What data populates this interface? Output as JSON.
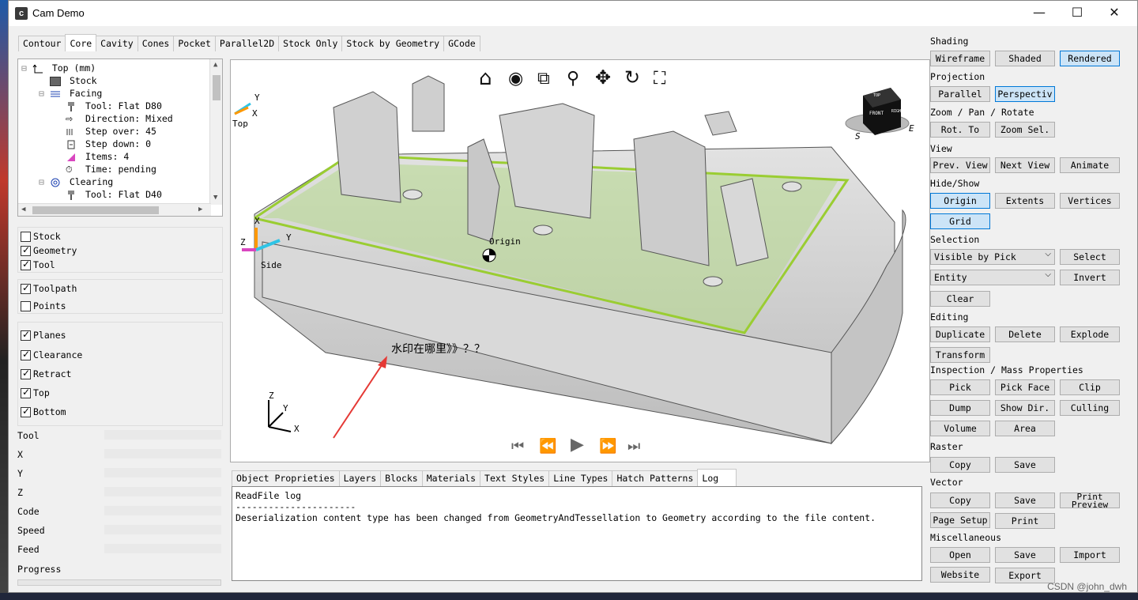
{
  "window": {
    "title": "Cam Demo",
    "icon_letter": "c",
    "min": "—",
    "max": "☐",
    "close": "✕"
  },
  "top_tabs": [
    "Contour",
    "Core",
    "Cavity",
    "Cones",
    "Pocket",
    "Parallel2D",
    "Stock Only",
    "Stock by Geometry",
    "GCode"
  ],
  "top_tab_active": "Core",
  "tree": {
    "items": [
      {
        "label": "Top (mm)",
        "icon": "axes-icon"
      },
      {
        "label": "Stock",
        "icon": "stock-icon"
      },
      {
        "label": "Facing",
        "icon": "facing-icon"
      },
      {
        "label": "Tool: Flat D80",
        "icon": "tool-icon"
      },
      {
        "label": "Direction: Mixed",
        "icon": "arrow-icon"
      },
      {
        "label": "Step over: 45",
        "icon": "stepover-icon"
      },
      {
        "label": "Step down: 0",
        "icon": "stepdown-icon"
      },
      {
        "label": "Items: 4",
        "icon": "items-icon"
      },
      {
        "label": "Time: pending",
        "icon": "clock-icon"
      },
      {
        "label": "Clearing",
        "icon": "clearing-icon"
      },
      {
        "label": "Tool: Flat D40",
        "icon": "tool-icon"
      }
    ]
  },
  "checks_1": [
    {
      "label": "Stock",
      "checked": false
    },
    {
      "label": "Geometry",
      "checked": true
    },
    {
      "label": "Tool",
      "checked": true
    }
  ],
  "checks_2": [
    {
      "label": "Toolpath",
      "checked": true
    },
    {
      "label": "Points",
      "checked": false
    }
  ],
  "checks_3": [
    {
      "label": "Planes",
      "checked": true
    },
    {
      "label": "Clearance",
      "checked": true
    },
    {
      "label": "Retract",
      "checked": true
    },
    {
      "label": "Top",
      "checked": true
    },
    {
      "label": "Bottom",
      "checked": true
    }
  ],
  "status": [
    "Tool",
    "X",
    "Y",
    "Z",
    "Code",
    "Speed",
    "Feed",
    "Progress"
  ],
  "viewport": {
    "labels": {
      "top": "Top",
      "side": "Side",
      "origin": "Origin",
      "x": "X",
      "y": "Y",
      "z": "Z"
    },
    "annotation": "水印在哪里》》？？",
    "cube_front": "FRONT",
    "cube_top": "TOP",
    "cube_right": "RIGHT",
    "compass_e": "E",
    "compass_s": "S",
    "toolbar_icons": [
      "home-icon",
      "eye-icon",
      "zoom-window-icon",
      "zoom-icon",
      "pan-icon",
      "rotate-icon",
      "fit-screen-icon"
    ],
    "nav": [
      "⏮",
      "⏪",
      "▶",
      "⏩",
      "⏭"
    ],
    "colors": {
      "part": "#c8c8c8",
      "highlight": "#9acd32",
      "plane": "#b5d98a"
    }
  },
  "bottom_tabs": [
    "Object Proprieties",
    "Layers",
    "Blocks",
    "Materials",
    "Text Styles",
    "Line Types",
    "Hatch Patterns",
    "Log"
  ],
  "bottom_tab_active": "Log",
  "log_lines": [
    "ReadFile log",
    "----------------------",
    "Deserialization content type has been changed from GeometryAndTessellation to Geometry according to the file content."
  ],
  "right": {
    "shading": {
      "title": "Shading",
      "buttons": [
        "Wireframe",
        "Shaded",
        "Rendered"
      ]
    },
    "projection": {
      "title": "Projection",
      "buttons": [
        "Parallel",
        "Perspectiv"
      ]
    },
    "zpr": {
      "title": "Zoom / Pan / Rotate",
      "buttons": [
        "Rot. To",
        "Zoom Sel."
      ]
    },
    "view": {
      "title": "View",
      "buttons": [
        "Prev. View",
        "Next View",
        "Animate"
      ]
    },
    "hideshow": {
      "title": "Hide/Show",
      "buttons": [
        "Origin",
        "Extents",
        "Vertices",
        "Grid"
      ]
    },
    "selection": {
      "title": "Selection",
      "dd1": "Visible by Pick",
      "dd2": "Entity",
      "buttons": [
        "Select",
        "Invert",
        "Clear"
      ]
    },
    "editing": {
      "title": "Editing",
      "buttons": [
        "Duplicate",
        "Delete",
        "Explode",
        "Transform"
      ]
    },
    "inspection": {
      "title": "Inspection / Mass Properties",
      "buttons": [
        "Pick",
        "Pick Face",
        "Clip",
        "Dump",
        "Show Dir.",
        "Culling",
        "Volume",
        "Area"
      ]
    },
    "raster": {
      "title": "Raster",
      "buttons": [
        "Copy",
        "Save"
      ]
    },
    "vector": {
      "title": "Vector",
      "buttons": [
        "Copy",
        "Save",
        "Print Preview",
        "Page Setup",
        "Print"
      ]
    },
    "misc": {
      "title": "Miscellaneous",
      "buttons": [
        "Open",
        "Save",
        "Import",
        "Website",
        "Export"
      ]
    }
  },
  "credit": "CSDN @john_dwh"
}
